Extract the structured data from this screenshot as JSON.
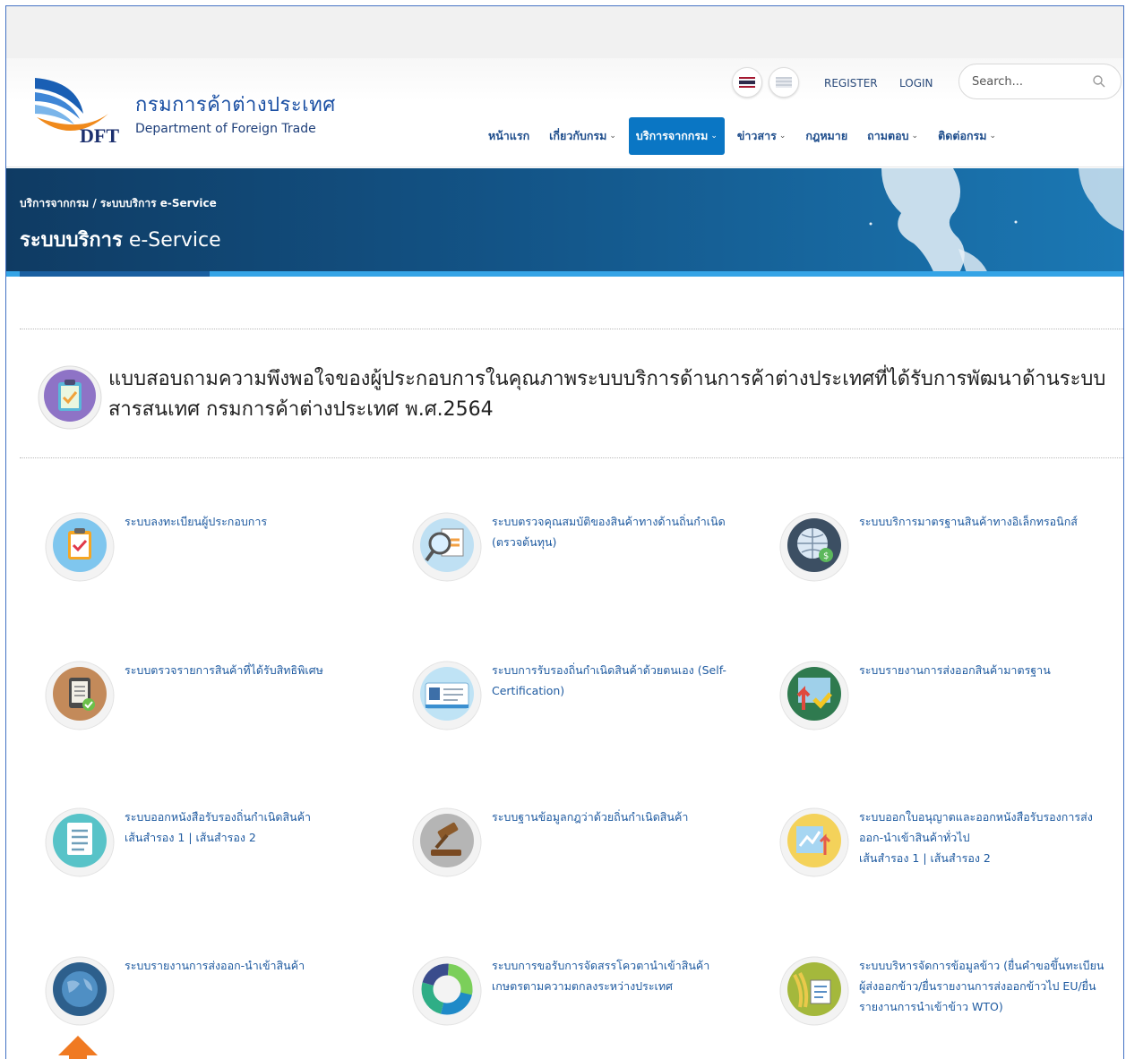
{
  "logo": {
    "abbr": "DFT",
    "name_th": "กรมการค้าต่างประเทศ",
    "name_en": "Department of Foreign Trade"
  },
  "header": {
    "register_label": "REGISTER",
    "login_label": "LOGIN",
    "search_placeholder": "Search...",
    "flags": [
      "thai-flag",
      "english-flag"
    ]
  },
  "nav": {
    "items": [
      {
        "label": "หน้าแรก",
        "chevron": ""
      },
      {
        "label": "เกี่ยวกับกรม",
        "chevron": "⌄"
      },
      {
        "label": "บริการจากกรม",
        "chevron": "⌄",
        "active": true
      },
      {
        "label": "ข่าวสาร",
        "chevron": "⌄"
      },
      {
        "label": "กฎหมาย",
        "chevron": ""
      },
      {
        "label": "ถามตอบ",
        "chevron": "⌄"
      },
      {
        "label": "ติดต่อกรม",
        "chevron": "⌄"
      }
    ]
  },
  "banner": {
    "breadcrumb": "บริการจากกรม / ระบบบริการ e-Service",
    "title_th": "ระบบบริการ",
    "title_en": " e-Service"
  },
  "survey": {
    "text": "แบบสอบถามความพึงพอใจของผู้ประกอบการในคุณภาพระบบบริการด้านการค้าต่างประเทศที่ได้รับการพัฒนาด้านระบบสารสนเทศ กรมการค้าต่างประเทศ พ.ศ.2564"
  },
  "services": [
    {
      "title": "ระบบลงทะเบียนผู้ประกอบการ",
      "icon": "clipboard-check-icon"
    },
    {
      "title": "ระบบตรวจคุณสมบัติของสินค้าทางด้านถิ่นกำเนิด (ตรวจต้นทุน)",
      "icon": "magnifier-document-icon"
    },
    {
      "title": "ระบบบริการมาตรฐานสินค้าทางอิเล็กทรอนิกส์",
      "icon": "globe-money-icon"
    },
    {
      "title": "ระบบตรวจรายการสินค้าที่ได้รับสิทธิพิเศษ",
      "icon": "tablet-check-icon"
    },
    {
      "title": "ระบบการรับรองถิ่นกำเนิดสินค้าด้วยตนเอง (Self-Certification)",
      "icon": "id-card-icon"
    },
    {
      "title": "ระบบรายงานการส่งออกสินค้ามาตรฐาน",
      "icon": "chart-arrows-icon"
    },
    {
      "title": "ระบบออกหนังสือรับรองถิ่นกำเนิดสินค้า",
      "icon": "checklist-icon",
      "sub": "เส้นสำรอง 1 | เส้นสำรอง 2"
    },
    {
      "title": "ระบบฐานข้อมูลกฎว่าด้วยถิ่นกำเนิดสินค้า",
      "icon": "gavel-icon"
    },
    {
      "title": "ระบบออกใบอนุญาตและออกหนังสือรับรองการส่งออก-นำเข้าสินค้าทั่วไป",
      "icon": "import-export-chart-icon",
      "sub": "เส้นสำรอง 1 | เส้นสำรอง 2"
    },
    {
      "title": "ระบบรายงานการส่งออก-นำเข้าสินค้า",
      "icon": "world-globe-icon"
    },
    {
      "title": "ระบบการขอรับการจัดสรรโควตานำเข้าสินค้าเกษตรตามความตกลงระหว่างประเทศ",
      "icon": "donut-chart-icon"
    },
    {
      "title": "ระบบบริหารจัดการข้อมูลข้าว (ยื่นคำขอขึ้นทะเบียนผู้ส่งออกข้าว/ยื่นรายงานการส่งออกข้าวไป EU/ยื่นรายงานการนำเข้าข้าว WTO)",
      "icon": "rice-document-icon"
    }
  ],
  "colors": {
    "accent": "#0a76c4",
    "link": "#1e5aa0",
    "banner": "#135487",
    "arrow": "#f07a22"
  }
}
